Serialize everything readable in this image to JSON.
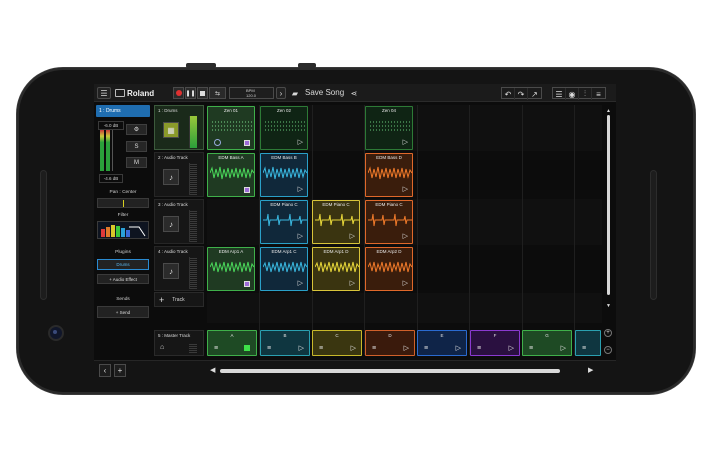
{
  "header": {
    "brand": "Roland",
    "bpm_label": "BPM",
    "bpm_value": "120.0",
    "song_title": "Save Song"
  },
  "left_panel": {
    "selected_track": "1 : Drums",
    "level_top": "-6.0 dB",
    "level_bottom": "-4.6 dB",
    "solo": "S",
    "mute": "M",
    "pan": "Pan : Center",
    "filter": "Filter",
    "plugins": "Plugins",
    "plugin_slot": "Drums",
    "add_effect": "+ Audio Effect",
    "sends": "Sends",
    "add_send": "+ Send"
  },
  "tracks": [
    {
      "name": "1 : Drums",
      "icon": "drum-pads-icon"
    },
    {
      "name": "2 : Audio Track",
      "icon": "guitar-icon"
    },
    {
      "name": "3 : Audio Track",
      "icon": "guitar-icon"
    },
    {
      "name": "4 : Audio Track",
      "icon": "guitar-icon"
    }
  ],
  "add_track_label": "Track",
  "master_label": "5 : Master Track",
  "clips": {
    "row1": [
      "Zen 01",
      "Zen 02",
      "",
      "Zen 04"
    ],
    "row2": [
      "EDM Bass A",
      "EDM Bass B",
      "",
      "EDM Bass D"
    ],
    "row3": [
      "",
      "EDM Piano C",
      "EDM Piano C",
      "EDM Piano C"
    ],
    "row4": [
      "EDM Arp1 A",
      "EDM Arp1 C",
      "EDM Arp1 D",
      "EDM Arp2 D"
    ]
  },
  "scenes": [
    {
      "name": "A",
      "color": "#2f8f3c"
    },
    {
      "name": "B",
      "color": "#1e7f8a"
    },
    {
      "name": "C",
      "color": "#a89a1c"
    },
    {
      "name": "D",
      "color": "#c0501e"
    },
    {
      "name": "E",
      "color": "#1e5ab0"
    },
    {
      "name": "F",
      "color": "#6a2aa0"
    },
    {
      "name": "G",
      "color": "#2f8f3c"
    },
    {
      "name": "",
      "color": "#1e7f8a"
    }
  ]
}
